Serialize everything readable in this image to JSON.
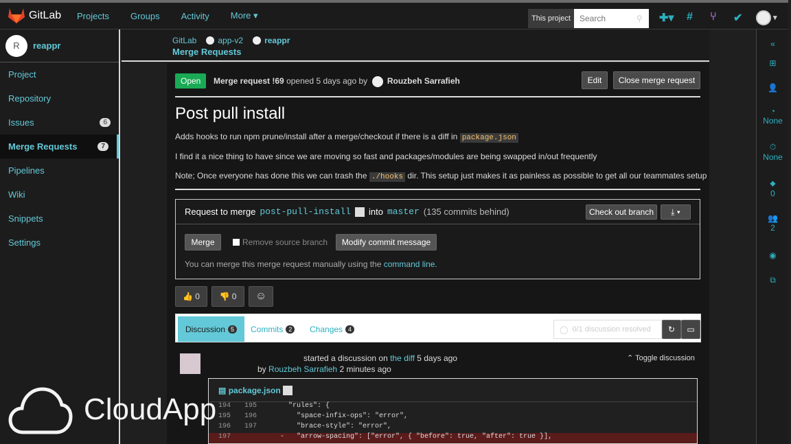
{
  "topbar": {
    "brand": "GitLab",
    "nav": [
      "Projects",
      "Groups",
      "Activity",
      "More"
    ],
    "scope": "This project",
    "search_placeholder": "Search"
  },
  "sidebar": {
    "avatar_letter": "R",
    "project": "reappr",
    "items": [
      {
        "label": "Project",
        "count": ""
      },
      {
        "label": "Repository",
        "count": ""
      },
      {
        "label": "Issues",
        "count": "6"
      },
      {
        "label": "Merge Requests",
        "count": "7"
      },
      {
        "label": "Pipelines",
        "count": ""
      },
      {
        "label": "Wiki",
        "count": ""
      },
      {
        "label": "Snippets",
        "count": ""
      },
      {
        "label": "Settings",
        "count": ""
      }
    ]
  },
  "breadcrumb": {
    "root": "GitLab",
    "group": "app-v2",
    "project": "reappr",
    "title": "Merge Requests"
  },
  "mr": {
    "status": "Open",
    "prefix": "Merge request",
    "id": "!69",
    "opened": "opened 5 days ago by",
    "author": "Rouzbeh Sarrafieh",
    "edit": "Edit",
    "close": "Close merge request",
    "title": "Post pull install",
    "desc1_a": "Adds hooks to run npm prune/install after a merge/checkout if there is a diff in",
    "desc1_code": "package.json",
    "desc2": "I find it a nice thing to have since we are moving so fast and packages/modules are being swapped in/out frequently",
    "desc3_a": "Note; Once everyone has done this we can trash the",
    "desc3_code": "./hooks",
    "desc3_b": "dir. This setup just makes it as painless as possible to get all our teammates setup"
  },
  "merge": {
    "request_to": "Request to merge",
    "source": "post-pull-install",
    "into": "into",
    "target": "master",
    "behind": "(135 commits behind)",
    "checkout": "Check out branch",
    "merge_btn": "Merge",
    "remove_source": "Remove source branch",
    "modify": "Modify commit message",
    "manual": "You can merge this merge request manually using the",
    "cmdline": "command line."
  },
  "reactions": {
    "up": "0",
    "down": "0"
  },
  "tabs": [
    {
      "label": "Discussion",
      "count": "5"
    },
    {
      "label": "Commits",
      "count": "2"
    },
    {
      "label": "Changes",
      "count": "4"
    }
  ],
  "discussion": {
    "started": "started a discussion on",
    "diff": "the diff",
    "when": "5 days ago",
    "by": "by",
    "author": "Rouzbeh Sarrafieh",
    "ago": "2 minutes ago",
    "toggle": "Toggle discussion",
    "resolved": "0/1 discussion resolved"
  },
  "diff": {
    "file": "package.json",
    "lines": [
      {
        "o": "194",
        "n": "195",
        "t": "  \"rules\": {"
      },
      {
        "o": "195",
        "n": "196",
        "t": "    \"space-infix-ops\": \"error\","
      },
      {
        "o": "196",
        "n": "197",
        "t": "    \"brace-style\": \"error\","
      },
      {
        "o": "197",
        "n": "",
        "t": "-   \"arrow-spacing\": [\"error\", { \"before\": true, \"after\": true }],"
      }
    ]
  },
  "rightbar": {
    "assignee": "None",
    "milestone": "None",
    "labels": "0",
    "participants": "2"
  },
  "watermark": "CloudApp"
}
